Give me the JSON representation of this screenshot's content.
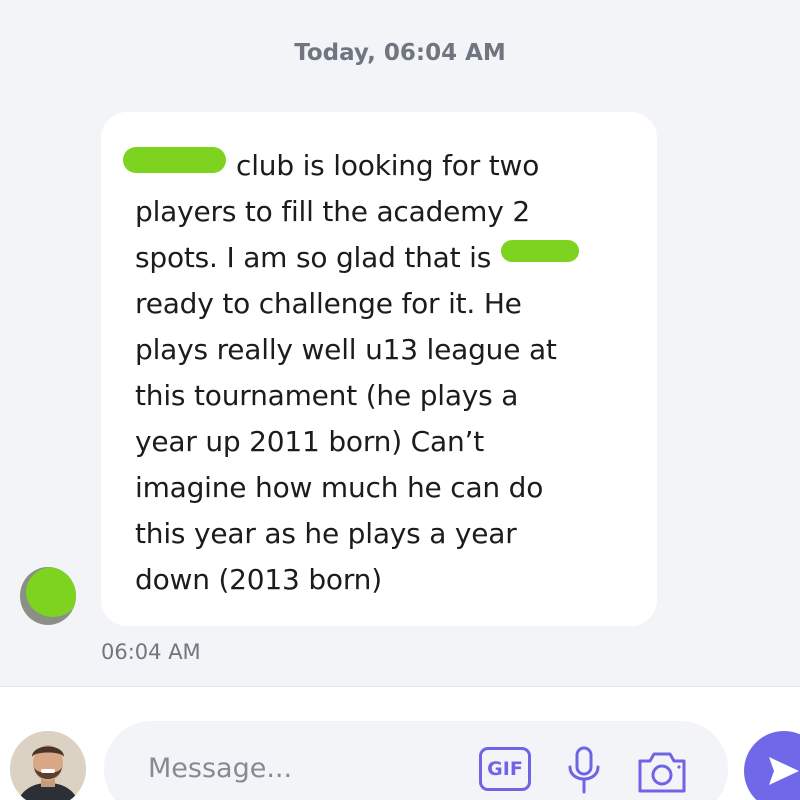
{
  "conversation": {
    "date_header": "Today, 06:04 AM",
    "message": {
      "text": "club is looking for two\nplayers to fill the academy 2\nspots. I am so glad that         is\nready to challenge for it. He\nplays really well u13 league at\nthis tournament (he plays a\nyear up 2011 born) Can’t\nimagine how much he can do\nthis year as he plays a year\ndown (2013 born)",
      "time": "06:04 AM"
    }
  },
  "composer": {
    "placeholder": "Message...",
    "gif_label": "GIF",
    "icons": [
      "gif-icon",
      "microphone-icon",
      "camera-icon",
      "send-icon"
    ]
  },
  "colors": {
    "background": "#f3f4f8",
    "bubble": "#ffffff",
    "accent": "#6f63e6",
    "redaction": "#7ed320",
    "muted_text": "#6f7680"
  }
}
